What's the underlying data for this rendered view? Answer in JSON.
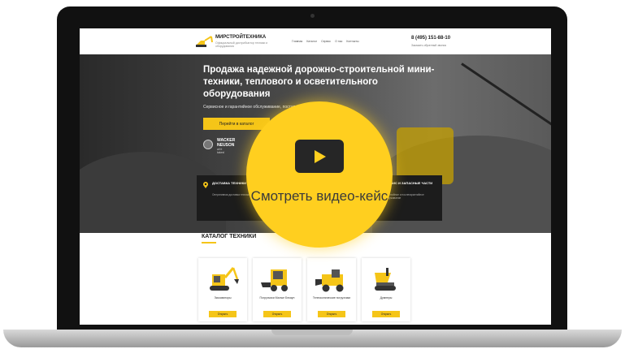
{
  "site": {
    "brand": "МИРСТРОЙТЕХНИКА",
    "brand_tagline": "Официальный дистрибьютор техники и оборудования",
    "nav": [
      "Главная",
      "Каталог",
      "Сервис",
      "О нас",
      "Контакты"
    ],
    "phone": "8 (495) 151-88-10",
    "callback": "Заказать обратный звонок"
  },
  "hero": {
    "title": "Продажа надежной дорожно-строительной мини-техники, теплового и осветительного оборудования",
    "subtitle": "Сервисное и гарантийное обслуживание, поставка запасных частей",
    "cta": "Перейти в каталог",
    "partner_name": "WACKER NEUSON",
    "partner_sub": "all it takes!"
  },
  "info": {
    "left_title": "ДОСТАВКА ТЕХНИКИ ПО ВСЕЙ РОССИИ",
    "left_text": "Оперативная доставка техники в любой регион",
    "right_title": "СЕРВИС И ЗАПАСНЫЕ ЧАСТИ",
    "right_text": "Гарантийное и послегарантийное обслуживание"
  },
  "catalog": {
    "title": "КАТАЛОГ ТЕХНИКИ",
    "items": [
      {
        "label": "Экскаваторы",
        "button": "Открыть"
      },
      {
        "label": "Погрузчики Малые Бекаун",
        "button": "Открыть"
      },
      {
        "label": "Телескопические погрузчики",
        "button": "Открыть"
      },
      {
        "label": "Думперы",
        "button": "Открыть"
      }
    ]
  },
  "video": {
    "label": "Смотреть видео-кейс"
  },
  "colors": {
    "accent": "#f5c518",
    "dark": "#1c1c1c"
  }
}
